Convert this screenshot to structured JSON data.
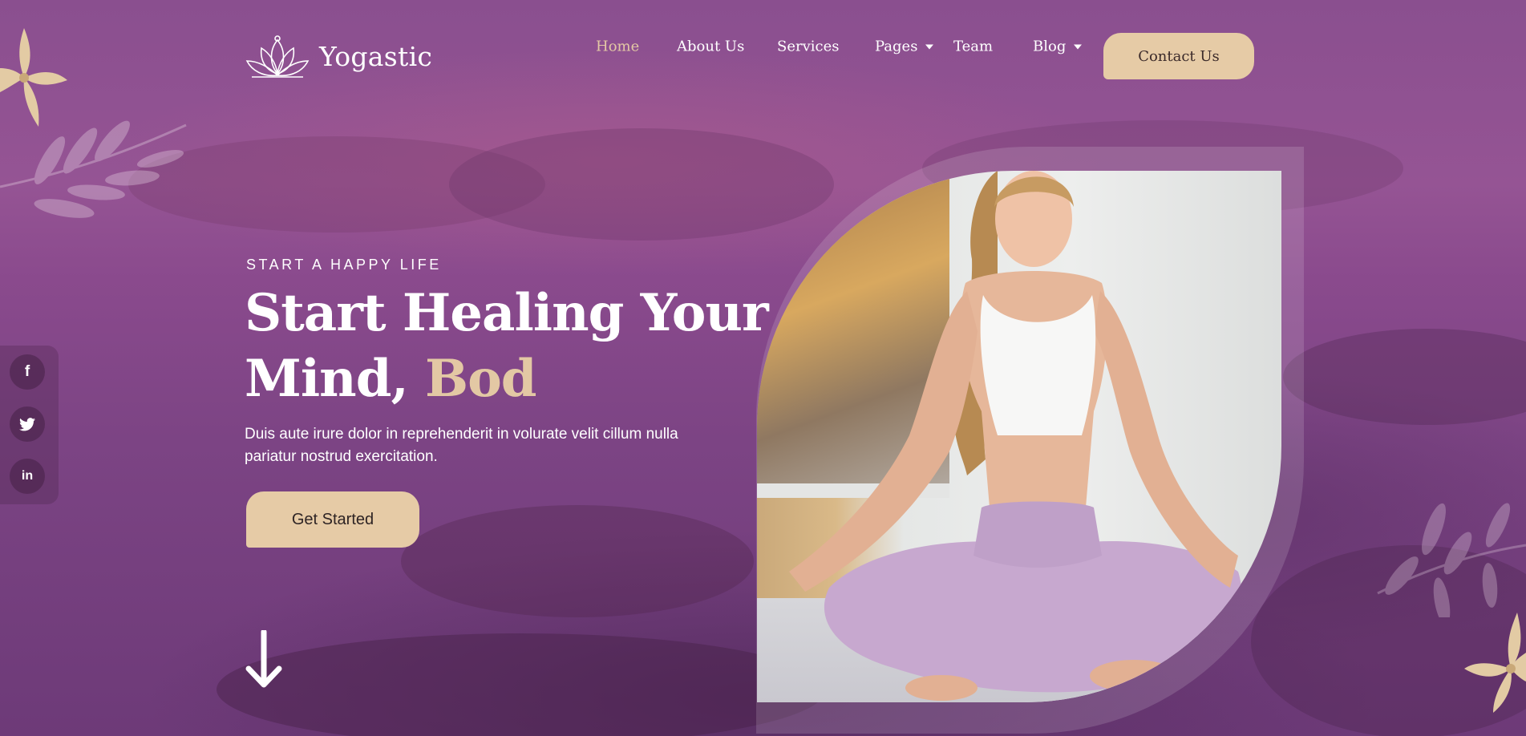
{
  "brand": {
    "name": "Yogastic",
    "logo_icon": "lotus-icon"
  },
  "nav": {
    "items": [
      {
        "label": "Home",
        "active": true,
        "dropdown": false
      },
      {
        "label": "About Us",
        "active": false,
        "dropdown": false
      },
      {
        "label": "Services",
        "active": false,
        "dropdown": false
      },
      {
        "label": "Pages",
        "active": false,
        "dropdown": true
      },
      {
        "label": "Team",
        "active": false,
        "dropdown": false
      },
      {
        "label": "Blog",
        "active": false,
        "dropdown": true
      }
    ],
    "contact_label": "Contact Us"
  },
  "hero": {
    "eyebrow": "START A HAPPY LIFE",
    "headline_line1": "Start Healing Your",
    "headline_line2": "Mind, ",
    "headline_accent": "Bod",
    "description": "Duis aute irure dolor in reprehenderit in volurate velit cillum nulla pariatur nostrud exercitation.",
    "cta_label": "Get Started",
    "scroll_icon": "arrow-down-icon"
  },
  "social": [
    {
      "name": "facebook",
      "glyph": "f"
    },
    {
      "name": "twitter",
      "glyph": "t"
    },
    {
      "name": "linkedin",
      "glyph": "in"
    }
  ],
  "colors": {
    "accent": "#e6cba6",
    "accent_text": "#e3c8a4",
    "background": "#8a4f8f"
  }
}
